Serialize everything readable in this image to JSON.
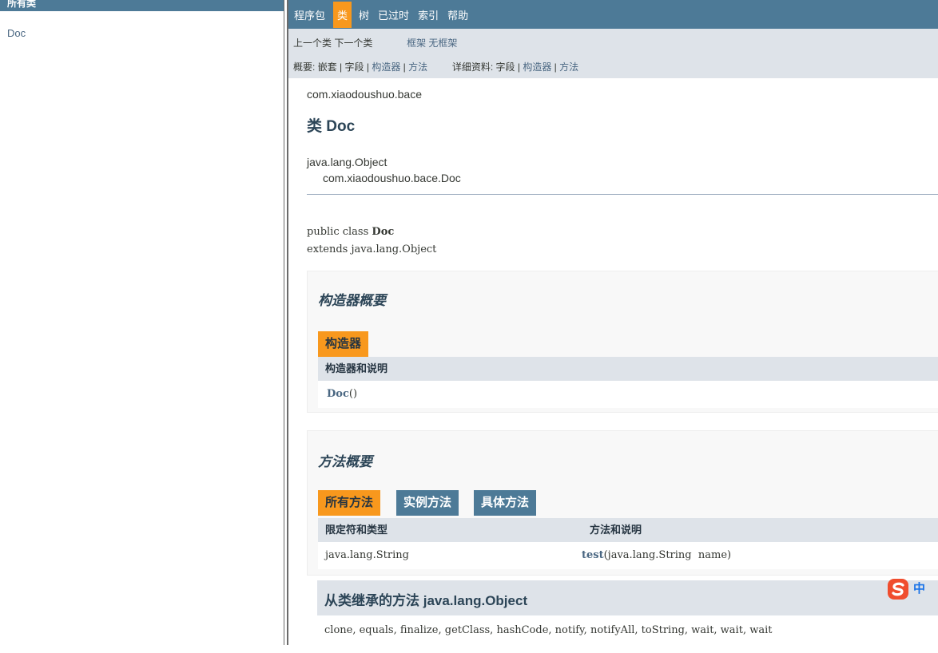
{
  "left_panel": {
    "header": "所有类",
    "items": [
      "Doc"
    ]
  },
  "top_nav": {
    "items": [
      "程序包",
      "类",
      "树",
      "已过时",
      "索引",
      "帮助"
    ],
    "active_index": 1
  },
  "sub_nav": {
    "prev_class": "上一个类",
    "next_class": "下一个类",
    "frames": "框架",
    "no_frames": "无框架",
    "summary_label": "概要:",
    "summary_items": [
      "嵌套",
      "字段",
      "构造器",
      "方法"
    ],
    "summary_links": [
      false,
      false,
      true,
      true
    ],
    "detail_label": "详细资料:",
    "detail_items": [
      "字段",
      "构造器",
      "方法"
    ],
    "detail_links": [
      false,
      true,
      true
    ]
  },
  "header": {
    "package": "com.xiaodoushuo.bace",
    "title": "类 Doc",
    "inheritance_parent": "java.lang.Object",
    "inheritance_child": "com.xiaodoushuo.bace.Doc"
  },
  "declaration": {
    "line1_prefix": "public class ",
    "line1_name": "Doc",
    "line2": "extends java.lang.Object"
  },
  "constructor_summary": {
    "title": "构造器概要",
    "tab": "构造器",
    "column_header": "构造器和说明",
    "rows": [
      {
        "name": "Doc",
        "params": "()"
      }
    ]
  },
  "method_summary": {
    "title": "方法概要",
    "tabs": [
      "所有方法",
      "实例方法",
      "具体方法"
    ],
    "active_tab": 0,
    "column_headers": [
      "限定符和类型",
      "方法和说明"
    ],
    "rows": [
      {
        "type": "java.lang.String",
        "name": "test",
        "params": "(java.lang.String  name)"
      }
    ]
  },
  "inherited": {
    "title": "从类继承的方法 java.lang.Object",
    "methods": "clone, equals, finalize, getClass, hashCode, notify, notifyAll, toString, wait, wait, wait"
  },
  "ime_indicator": {
    "label": "中",
    "color": "#f04d2e"
  },
  "colors": {
    "nav_bg": "#4d7a97",
    "active_tab": "#f8981d",
    "subnav_bg": "#dee3e9",
    "title_color": "#2c4557",
    "link_color": "#4a6782"
  }
}
